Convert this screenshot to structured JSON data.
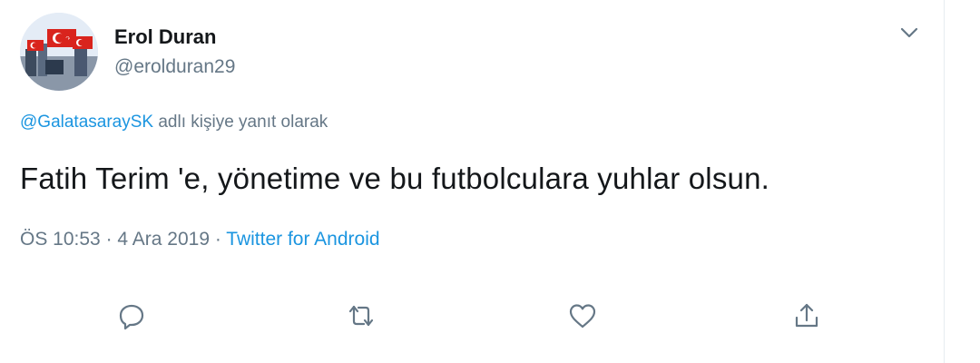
{
  "tweet": {
    "author_name": "Erol Duran",
    "author_handle": "@erolduran29",
    "reply_to": "@GalatasaraySK",
    "reply_suffix": " adlı kişiye yanıt olarak",
    "text": "Fatih Terim 'e, yönetime ve bu futbolculara yuhlar olsun.",
    "time": "ÖS 10:53",
    "separator": " · ",
    "date": "4 Ara 2019",
    "source": "Twitter for Android"
  },
  "icons": {
    "reply": "reply-icon",
    "retweet": "retweet-icon",
    "like": "heart-icon",
    "share": "share-icon",
    "more": "chevron-down-icon"
  },
  "colors": {
    "link": "#1b95e0",
    "secondary": "#657786",
    "primary": "#14171a"
  }
}
